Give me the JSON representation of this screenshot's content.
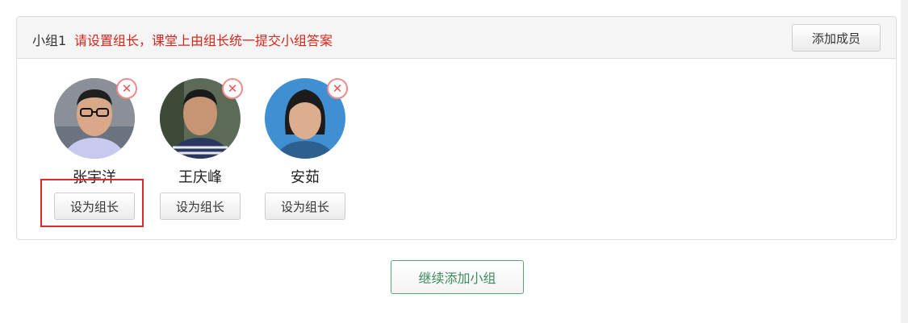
{
  "group": {
    "name": "小组1",
    "hint": "请设置组长，课堂上由组长统一提交小组答案",
    "add_member_label": "添加成员"
  },
  "members": [
    {
      "name": "张宇洋",
      "set_leader_label": "设为组长",
      "remove_icon": "close-icon"
    },
    {
      "name": "王庆峰",
      "set_leader_label": "设为组长",
      "remove_icon": "close-icon"
    },
    {
      "name": "安茹",
      "set_leader_label": "设为组长",
      "remove_icon": "close-icon"
    }
  ],
  "continue_label": "继续添加小组",
  "colors": {
    "hint": "#d9261c",
    "highlight": "#e02a2a",
    "continue_border": "#5aa876",
    "remove": "#e25555"
  }
}
